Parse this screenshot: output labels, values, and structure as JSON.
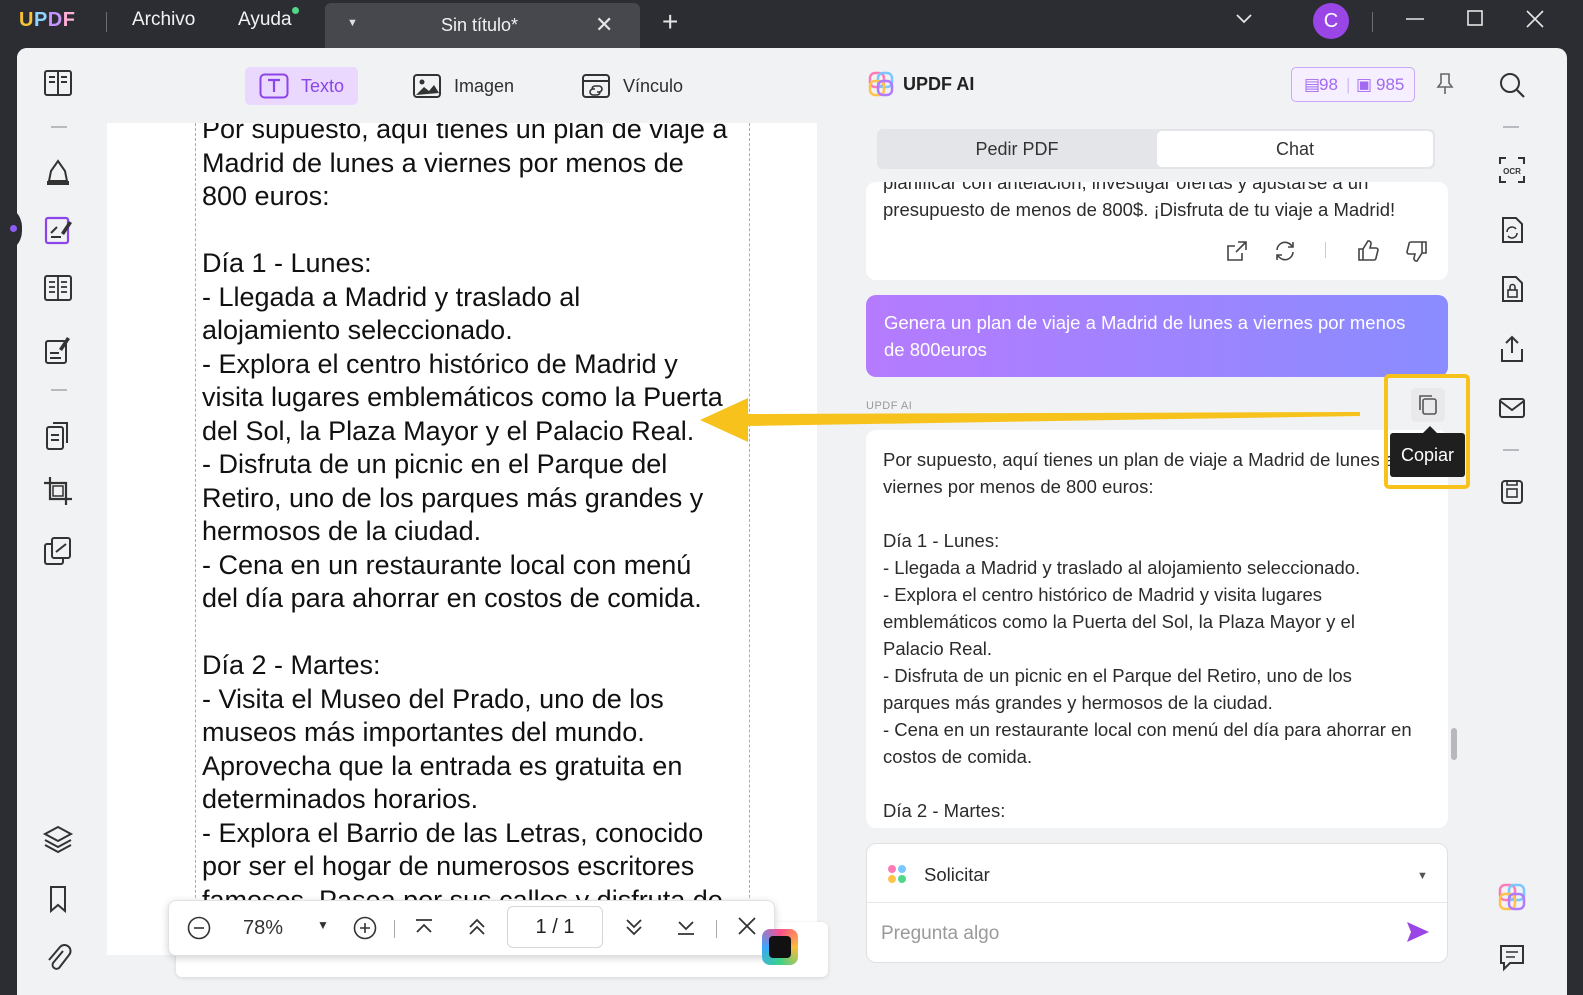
{
  "titlebar": {
    "logo": "UPDF",
    "menu_file": "Archivo",
    "menu_help": "Ayuda",
    "tab_title": "Sin título*",
    "tab_close": "✕",
    "tab_add": "+",
    "avatar_letter": "C"
  },
  "edit_toolbar": {
    "text_label": "Texto",
    "image_label": "Imagen",
    "link_label": "Vínculo"
  },
  "document": {
    "text": "Por supuesto, aquí tienes un plan de viaje a\nMadrid de lunes a viernes por menos de\n800 euros:\n\nDía 1 - Lunes:\n- Llegada a Madrid y traslado al\nalojamiento seleccionado.\n- Explora el centro histórico de Madrid y\nvisita lugares emblemáticos como la Puerta\ndel Sol, la Plaza Mayor y el Palacio Real.\n- Disfruta de un picnic en el Parque del\nRetiro, uno de los parques más grandes y\nhermosos de la ciudad.\n- Cena en un restaurante local con menú\ndel día para ahorrar en costos de comida.\n\nDía 2 - Martes:\n- Visita el Museo del Prado, uno de los\nmuseos más importantes del mundo.\nAprovecha que la entrada es gratuita en\ndeterminados horarios.\n- Explora el Barrio de las Letras, conocido\npor ser el hogar de numerosos escritores\nfamosos. Pasea por sus calles y disfruta de\nsus cafés y tiendas."
  },
  "zoom_bar": {
    "zoom_value": "78%",
    "page_indicator": "1 / 1"
  },
  "ai_panel": {
    "title": "UPDF AI",
    "credits_doc": "98",
    "credits_chat": "985",
    "tab_pdf": "Pedir PDF",
    "tab_chat": "Chat",
    "prev_answer": "planificar con antelación, investigar ofertas y ajustarse a un\npresupuesto de menos de 800$. ¡Disfruta de tu viaje a Madrid!",
    "user_message": "Genera un plan de viaje a Madrid de lunes a viernes por menos de 800euros",
    "ai_label": "UPDF AI",
    "copy_tooltip": "Copiar",
    "answer": "Por supuesto, aquí tienes un plan de viaje a Madrid de lunes a\nviernes por menos de 800 euros:\n\nDía 1 - Lunes:\n- Llegada a Madrid y traslado al alojamiento seleccionado.\n- Explora el centro histórico de Madrid y visita lugares\nemblemáticos como la Puerta del Sol, la Plaza Mayor y el\nPalacio Real.\n- Disfruta de un picnic en el Parque del Retiro, uno de los\nparques más grandes y hermosos de la ciudad.\n- Cena en un restaurante local con menú del día para ahorrar en\ncostos de comida.\n\nDía 2 - Martes:",
    "prompt_selector": "Solicitar",
    "input_placeholder": "Pregunta algo"
  },
  "colors": {
    "accent": "#8b45e8",
    "highlight": "#f6c21b"
  }
}
